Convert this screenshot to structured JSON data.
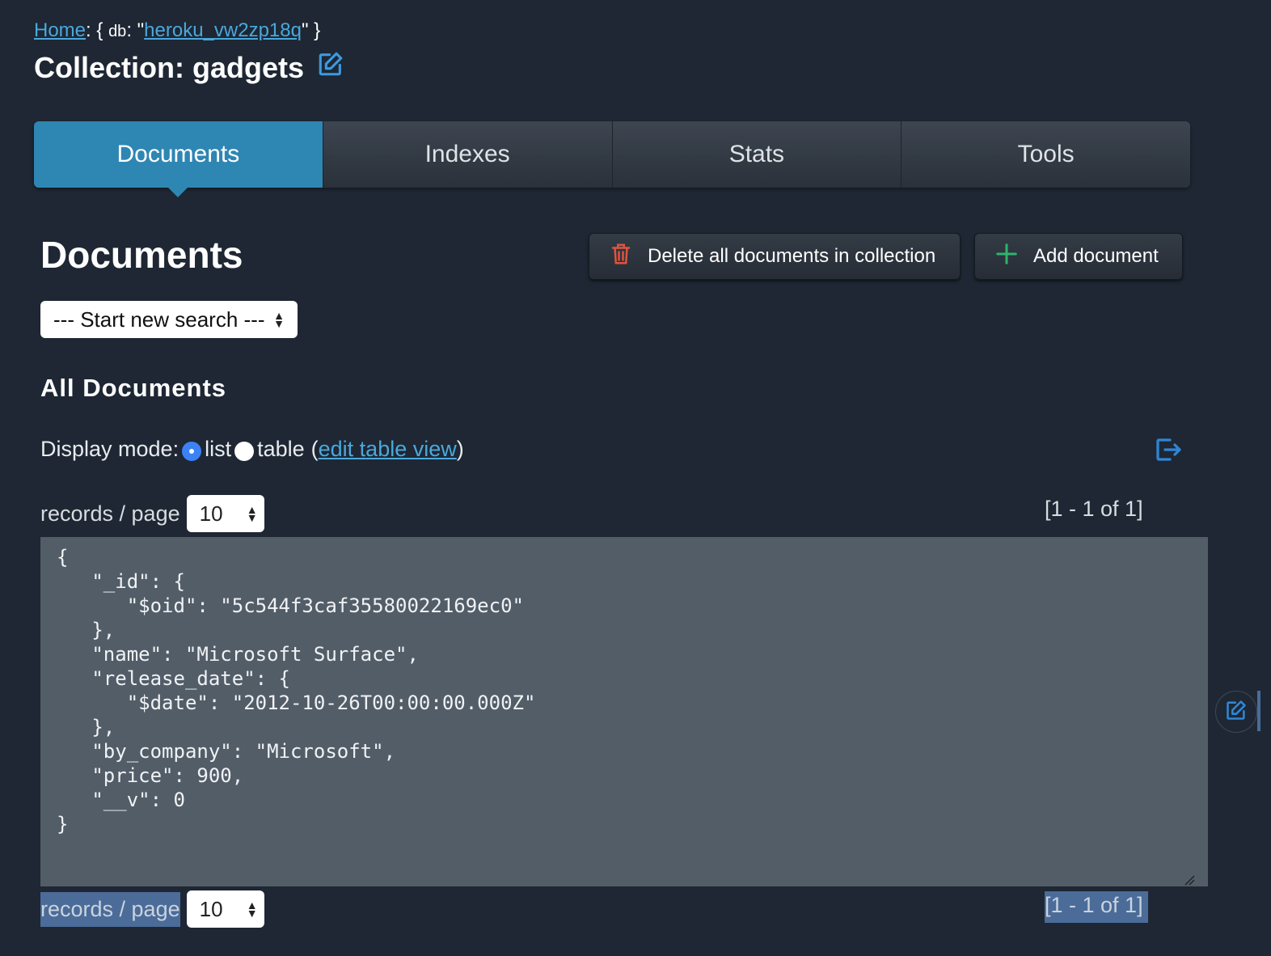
{
  "breadcrumb": {
    "home": "Home",
    "sep1": ": {",
    "db_label": "db",
    "sep2": ": \"",
    "db_name": "heroku_vw2zp18q",
    "sep3": "\" }"
  },
  "page_title": "Collection: gadgets",
  "tabs": [
    {
      "label": "Documents",
      "active": true
    },
    {
      "label": "Indexes",
      "active": false
    },
    {
      "label": "Stats",
      "active": false
    },
    {
      "label": "Tools",
      "active": false
    }
  ],
  "section_heading": "Documents",
  "buttons": {
    "delete_all": "Delete all documents in collection",
    "add_document": "Add document"
  },
  "search_select": {
    "selected": "--- Start new search ---"
  },
  "all_documents_heading": "All Documents",
  "display_mode": {
    "label": "Display mode:",
    "list": "list",
    "table": "table",
    "edit_link": "edit table view",
    "open_paren": "(",
    "close_paren": ")",
    "selected": "list"
  },
  "pagination": {
    "records_label": "records / page",
    "per_page": "10",
    "range": "[1 - 1 of 1]"
  },
  "document_json": "{\n   \"_id\": {\n      \"$oid\": \"5c544f3caf35580022169ec0\"\n   },\n   \"name\": \"Microsoft Surface\",\n   \"release_date\": {\n      \"$date\": \"2012-10-26T00:00:00.000Z\"\n   },\n   \"by_company\": \"Microsoft\",\n   \"price\": 900,\n   \"__v\": 0\n}",
  "colors": {
    "background": "#1e2733",
    "accent": "#2e86b3",
    "link": "#4aa8dc",
    "delete_icon": "#e0533d",
    "add_icon": "#2fb36b"
  },
  "icons": {
    "edit_collection": "edit-icon",
    "delete": "trash-icon",
    "add": "plus-icon",
    "export": "export-icon",
    "edit_document": "edit-icon"
  }
}
